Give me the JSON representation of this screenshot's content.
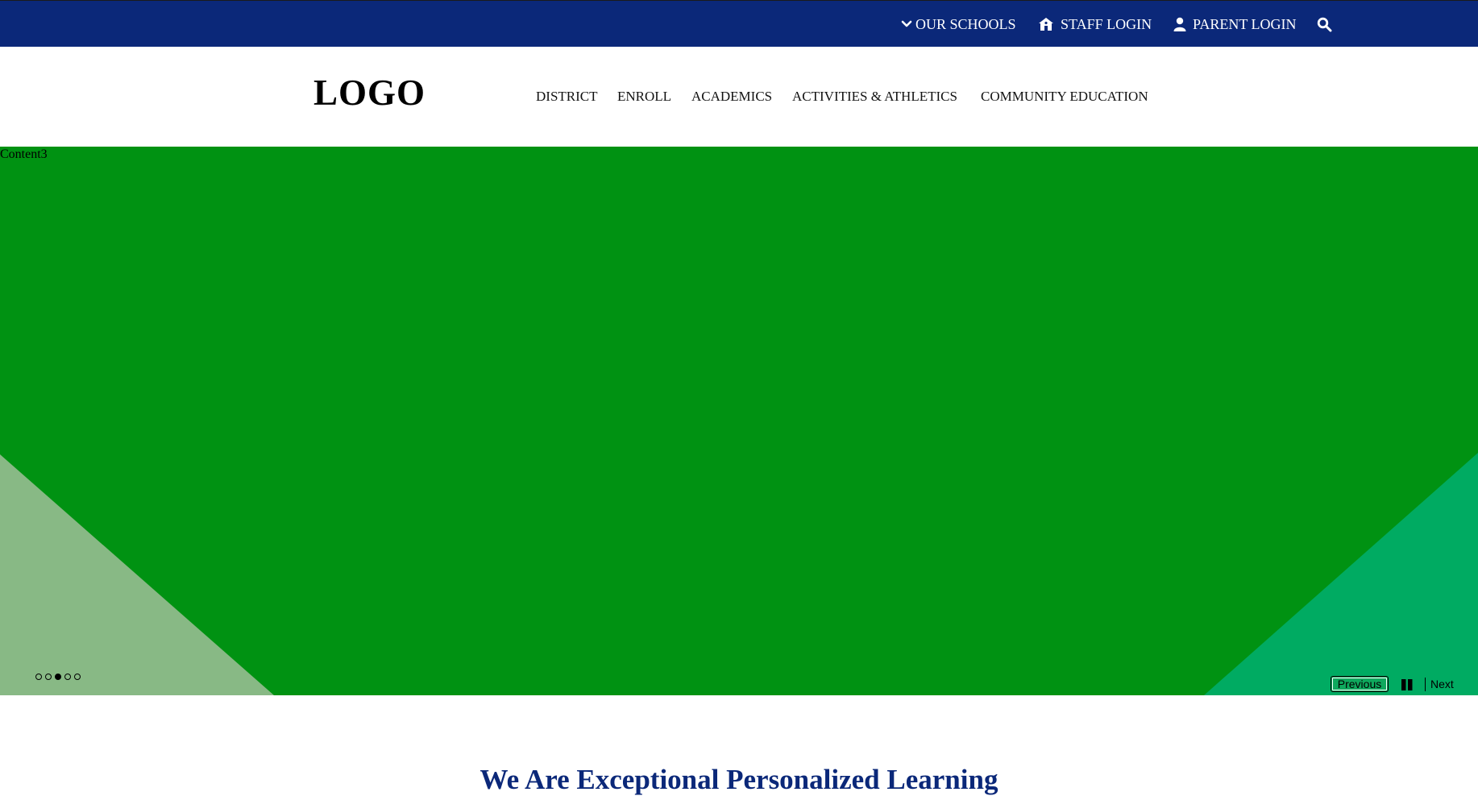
{
  "topbar": {
    "our_schools": "OUR SCHOOLS",
    "staff_login": "STAFF LOGIN",
    "parent_login": "PARENT LOGIN",
    "search_icon": "search-icon",
    "bg_color": "#0b2879"
  },
  "header": {
    "logo": "LOGO",
    "nav": [
      "DISTRICT",
      "ENROLL",
      "ACADEMICS",
      "ACTIVITIES & ATHLETICS",
      "COMMUNITY EDUCATION"
    ]
  },
  "hero": {
    "label": "Content3",
    "bg_color": "#009212",
    "left_triangle_color": "#88b985",
    "right_triangle_color": "#00ab62",
    "slide_count": 5,
    "active_slide": 3,
    "controls": {
      "previous": "Previous",
      "next": "Next",
      "pause_icon": "pause-icon"
    }
  },
  "main": {
    "headline": "We Are Exceptional Personalized Learning"
  }
}
